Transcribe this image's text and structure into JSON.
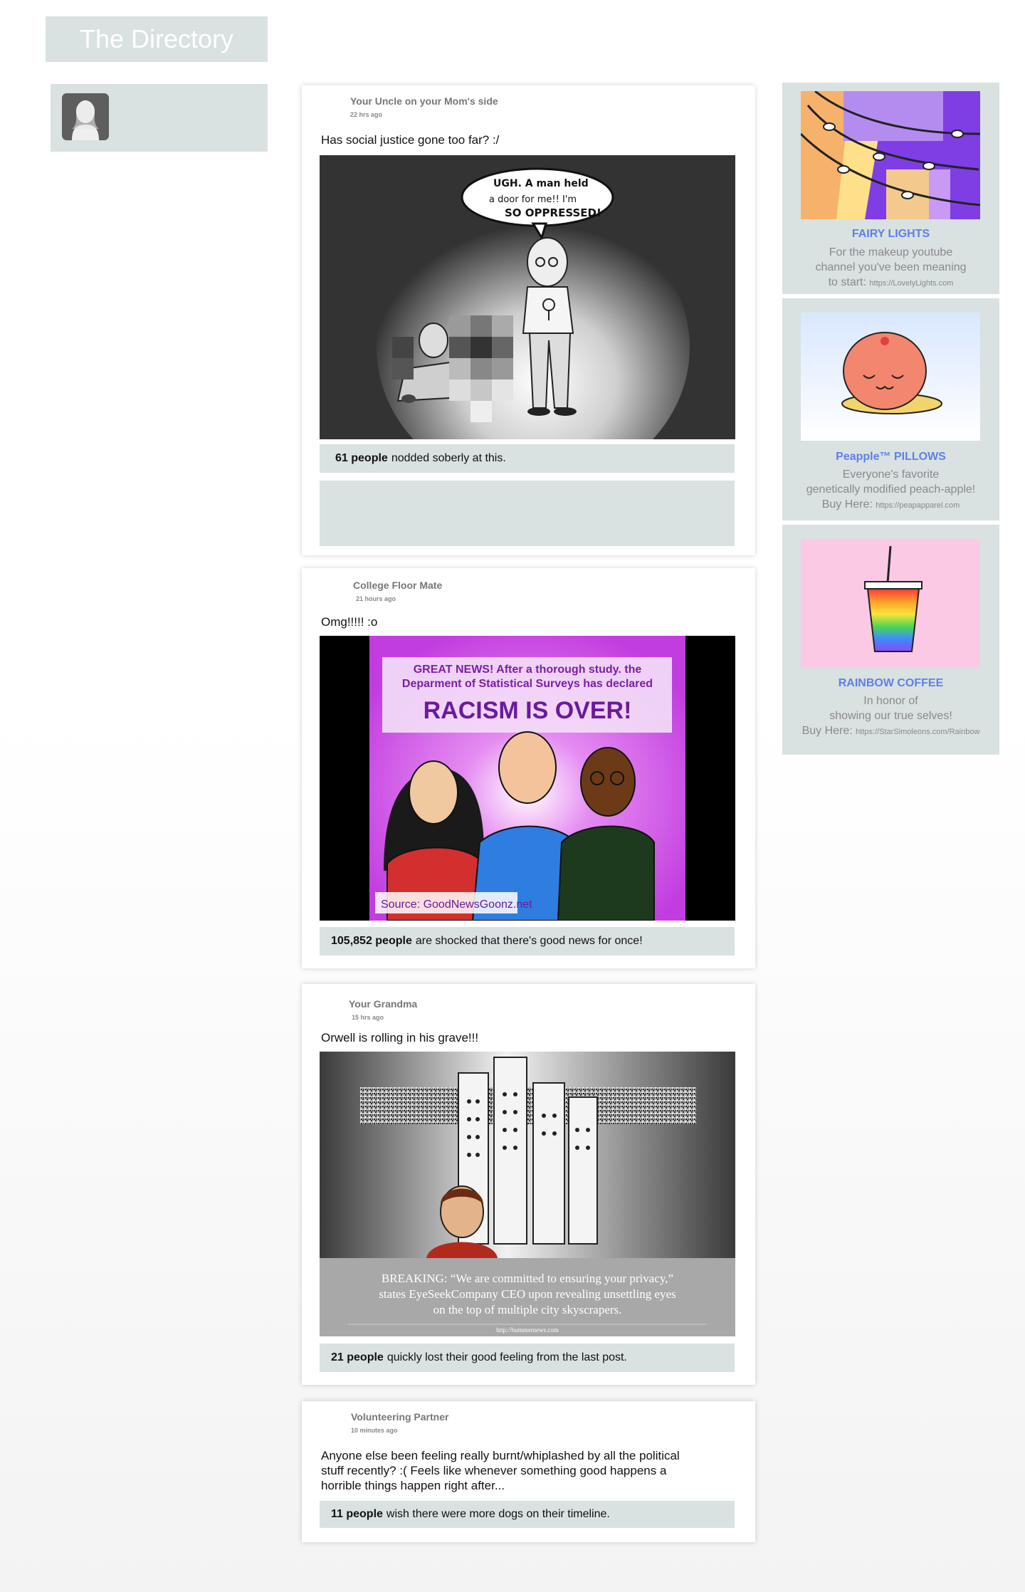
{
  "header": {
    "title": "The Directory"
  },
  "posts": [
    {
      "author": "Your Uncle on your Mom's side",
      "time": "22 hrs ago",
      "caption": "Has social justice gone too far? :/",
      "comic_text": [
        "UGH. A man held",
        "a door for me!! I'm",
        "SO OPPRESSED!"
      ],
      "reaction_count": "61 people",
      "reaction_text": "nodded soberly at this."
    },
    {
      "author": "College Floor Mate",
      "time": "21 hours ago",
      "caption": "Omg!!!!! :o",
      "headline_lines": [
        "GREAT NEWS! After a thorough study. the",
        "Deparment of Statistical Surveys has declared"
      ],
      "headline_big": "RACISM IS OVER!",
      "source": "Source: GoodNewsGoonz.net",
      "reaction_count": "105,852 people",
      "reaction_text": "are shocked that there's good news for once!"
    },
    {
      "author": "Your Grandma",
      "time": "15 hrs ago",
      "caption": "Orwell is rolling in his grave!!!",
      "news_lines": [
        "BREAKING: “We are committed to ensuring your privacy,”",
        "states EyeSeekCompany CEO upon revealing unsettling eyes",
        "on the top of multiple city skyscrapers."
      ],
      "news_url": "http://bummernews.com",
      "reaction_count": "21 people",
      "reaction_text": "quickly lost their good feeling from the last post."
    },
    {
      "author": "Volunteering Partner",
      "time": "10 minutes ago",
      "caption_lines": [
        "Anyone else been feeling really burnt/whiplashed by all the political",
        "stuff recently? :( Feels like whenever something good happens a",
        "horrible things happen right after..."
      ],
      "reaction_count": "11 people",
      "reaction_text": "wish there were more dogs on their timeline."
    }
  ],
  "ads": [
    {
      "title": "FAIRY LIGHTS",
      "lines": [
        "For the makeup youtube",
        "channel you've been meaning"
      ],
      "last_prefix": "to start: ",
      "url": "https://LovelyLights.com",
      "art": "fairy-lights-image"
    },
    {
      "title": "Peapple™ PILLOWS",
      "lines": [
        "Everyone's favorite",
        "genetically modified peach-apple!"
      ],
      "last_prefix": "Buy Here: ",
      "url": "https://peapapparel.com",
      "art": "peach-pillow-image"
    },
    {
      "title": "RAINBOW COFFEE",
      "lines": [
        "In honor of",
        "showing our true selves!"
      ],
      "last_prefix": "Buy Here: ",
      "url": "https://StarSimoleons.com/Rainbow",
      "art": "rainbow-drink-image"
    }
  ],
  "colors": {
    "panel": "#d9e1e1",
    "ad_title": "#5f7fe8",
    "headline_purple": "#6a1b9a"
  }
}
